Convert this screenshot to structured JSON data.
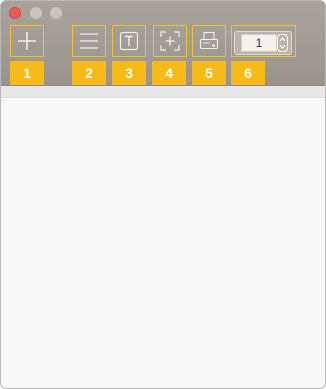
{
  "window": {
    "traffic_lights": [
      "close",
      "minimize",
      "zoom"
    ],
    "colors": {
      "toolbar": "#a39d97",
      "highlight": "#f5c131",
      "badge": "#f7bb17",
      "close": "#ef5a54"
    }
  },
  "toolbar": {
    "buttons": [
      {
        "icon": "plus-icon",
        "badge": "1"
      },
      {
        "icon": "list-icon",
        "badge": "2"
      },
      {
        "icon": "text-icon",
        "badge": "3"
      },
      {
        "icon": "add-selection-icon",
        "badge": "4"
      },
      {
        "icon": "printer-icon",
        "badge": "5"
      },
      {
        "icon": "stepper-icon",
        "badge": "6"
      }
    ],
    "stepper_value": "1"
  }
}
